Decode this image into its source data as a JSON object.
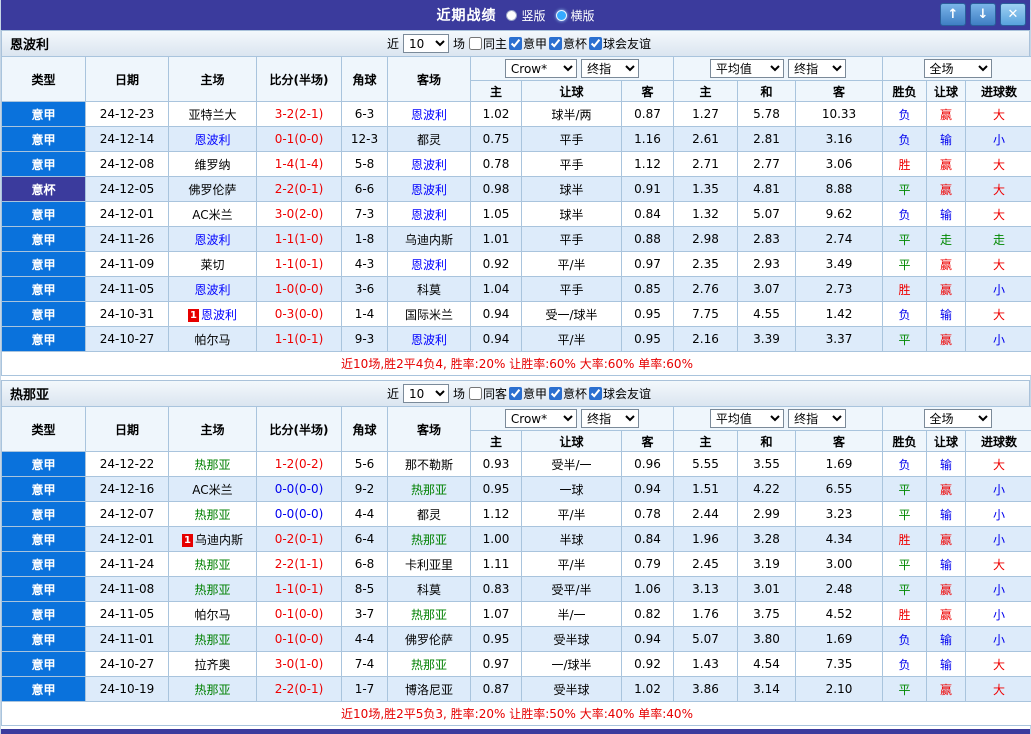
{
  "titlebar": {
    "title": "近期战绩",
    "vertical_label": "竖版",
    "horizontal_label": "横版",
    "selected_layout": "横版",
    "btn_up": "↑",
    "btn_down": "↓",
    "btn_close": "✕"
  },
  "labels": {
    "near": "近",
    "games": "场"
  },
  "colors": {
    "titlebar_bg": "#3b3b9d",
    "league_cell_bg": "#0a72dc",
    "cup_cell_bg": "#3b3b9d",
    "alt_row_bg": "#ddebfa",
    "win_red": "#ee0000",
    "lose_blue": "#0000ee",
    "draw_green": "#008800",
    "team_blue": "#0000ff",
    "team_green": "#008000",
    "summary_red": "#e60000"
  },
  "hdr": {
    "col_type": "类型",
    "col_date": "日期",
    "col_home": "主场",
    "col_score": "比分(半场)",
    "col_corner": "角球",
    "col_away": "客场",
    "dd_crow": "Crow*",
    "dd_final": "终指",
    "dd_avg": "平均值",
    "dd_full": "全场",
    "sub_home": "主",
    "sub_handicap": "让球",
    "sub_away": "客",
    "sub_draw": "和",
    "sub_result": "胜负",
    "sub_goals": "进球数"
  },
  "sections": [
    {
      "team": "恩波利",
      "filter": {
        "count": "10",
        "checks": [
          {
            "label": "同主",
            "checked": false
          },
          {
            "label": "意甲",
            "checked": true
          },
          {
            "label": "意杯",
            "checked": true
          },
          {
            "label": "球会友谊",
            "checked": true
          }
        ]
      },
      "rows": [
        {
          "league": "意甲",
          "cup": false,
          "date": "24-12-23",
          "home": "亚特兰大",
          "home_class": "",
          "home_badge": "",
          "score": "3-2(2-1)",
          "score_class": "red",
          "corner": "6-3",
          "away": "恩波利",
          "away_class": "blue",
          "away_badge": "",
          "odds": [
            "1.02",
            "球半/两",
            "0.87",
            "1.27",
            "5.78",
            "10.33"
          ],
          "result": "负",
          "result_class": "blue",
          "asian": "赢",
          "asian_class": "red",
          "ou": "大",
          "ou_class": "red"
        },
        {
          "league": "意甲",
          "cup": false,
          "date": "24-12-14",
          "home": "恩波利",
          "home_class": "blue",
          "home_badge": "",
          "score": "0-1(0-0)",
          "score_class": "red",
          "corner": "12-3",
          "away": "都灵",
          "away_class": "",
          "away_badge": "",
          "odds": [
            "0.75",
            "平手",
            "1.16",
            "2.61",
            "2.81",
            "3.16"
          ],
          "result": "负",
          "result_class": "blue",
          "asian": "输",
          "asian_class": "blue",
          "ou": "小",
          "ou_class": "blue"
        },
        {
          "league": "意甲",
          "cup": false,
          "date": "24-12-08",
          "home": "维罗纳",
          "home_class": "",
          "home_badge": "",
          "score": "1-4(1-4)",
          "score_class": "red",
          "corner": "5-8",
          "away": "恩波利",
          "away_class": "blue",
          "away_badge": "",
          "odds": [
            "0.78",
            "平手",
            "1.12",
            "2.71",
            "2.77",
            "3.06"
          ],
          "result": "胜",
          "result_class": "red",
          "asian": "赢",
          "asian_class": "red",
          "ou": "大",
          "ou_class": "red"
        },
        {
          "league": "意杯",
          "cup": true,
          "date": "24-12-05",
          "home": "佛罗伦萨",
          "home_class": "",
          "home_badge": "",
          "score": "2-2(0-1)",
          "score_class": "red",
          "corner": "6-6",
          "away": "恩波利",
          "away_class": "blue",
          "away_badge": "",
          "odds": [
            "0.98",
            "球半",
            "0.91",
            "1.35",
            "4.81",
            "8.88"
          ],
          "result": "平",
          "result_class": "green",
          "asian": "赢",
          "asian_class": "red",
          "ou": "大",
          "ou_class": "red"
        },
        {
          "league": "意甲",
          "cup": false,
          "date": "24-12-01",
          "home": "AC米兰",
          "home_class": "",
          "home_badge": "",
          "score": "3-0(2-0)",
          "score_class": "red",
          "corner": "7-3",
          "away": "恩波利",
          "away_class": "blue",
          "away_badge": "",
          "odds": [
            "1.05",
            "球半",
            "0.84",
            "1.32",
            "5.07",
            "9.62"
          ],
          "result": "负",
          "result_class": "blue",
          "asian": "输",
          "asian_class": "blue",
          "ou": "大",
          "ou_class": "red"
        },
        {
          "league": "意甲",
          "cup": false,
          "date": "24-11-26",
          "home": "恩波利",
          "home_class": "blue",
          "home_badge": "",
          "score": "1-1(1-0)",
          "score_class": "red",
          "corner": "1-8",
          "away": "乌迪内斯",
          "away_class": "",
          "away_badge": "",
          "odds": [
            "1.01",
            "平手",
            "0.88",
            "2.98",
            "2.83",
            "2.74"
          ],
          "result": "平",
          "result_class": "green",
          "asian": "走",
          "asian_class": "green",
          "ou": "走",
          "ou_class": "green"
        },
        {
          "league": "意甲",
          "cup": false,
          "date": "24-11-09",
          "home": "莱切",
          "home_class": "",
          "home_badge": "",
          "score": "1-1(0-1)",
          "score_class": "red",
          "corner": "4-3",
          "away": "恩波利",
          "away_class": "blue",
          "away_badge": "",
          "odds": [
            "0.92",
            "平/半",
            "0.97",
            "2.35",
            "2.93",
            "3.49"
          ],
          "result": "平",
          "result_class": "green",
          "asian": "赢",
          "asian_class": "red",
          "ou": "大",
          "ou_class": "red"
        },
        {
          "league": "意甲",
          "cup": false,
          "date": "24-11-05",
          "home": "恩波利",
          "home_class": "blue",
          "home_badge": "",
          "score": "1-0(0-0)",
          "score_class": "red",
          "corner": "3-6",
          "away": "科莫",
          "away_class": "",
          "away_badge": "",
          "odds": [
            "1.04",
            "平手",
            "0.85",
            "2.76",
            "3.07",
            "2.73"
          ],
          "result": "胜",
          "result_class": "red",
          "asian": "赢",
          "asian_class": "red",
          "ou": "小",
          "ou_class": "blue"
        },
        {
          "league": "意甲",
          "cup": false,
          "date": "24-10-31",
          "home": "恩波利",
          "home_class": "blue",
          "home_badge": "1",
          "score": "0-3(0-0)",
          "score_class": "red",
          "corner": "1-4",
          "away": "国际米兰",
          "away_class": "",
          "away_badge": "",
          "odds": [
            "0.94",
            "受一/球半",
            "0.95",
            "7.75",
            "4.55",
            "1.42"
          ],
          "result": "负",
          "result_class": "blue",
          "asian": "输",
          "asian_class": "blue",
          "ou": "大",
          "ou_class": "red"
        },
        {
          "league": "意甲",
          "cup": false,
          "date": "24-10-27",
          "home": "帕尔马",
          "home_class": "",
          "home_badge": "",
          "score": "1-1(0-1)",
          "score_class": "red",
          "corner": "9-3",
          "away": "恩波利",
          "away_class": "blue",
          "away_badge": "",
          "odds": [
            "0.94",
            "平/半",
            "0.95",
            "2.16",
            "3.39",
            "3.37"
          ],
          "result": "平",
          "result_class": "green",
          "asian": "赢",
          "asian_class": "red",
          "ou": "小",
          "ou_class": "blue"
        }
      ],
      "summary": "近10场,胜2平4负4, 胜率:20% 让胜率:60% 大率:60% 单率:60%"
    },
    {
      "team": "热那亚",
      "filter": {
        "count": "10",
        "checks": [
          {
            "label": "同客",
            "checked": false
          },
          {
            "label": "意甲",
            "checked": true
          },
          {
            "label": "意杯",
            "checked": true
          },
          {
            "label": "球会友谊",
            "checked": true
          }
        ]
      },
      "rows": [
        {
          "league": "意甲",
          "cup": false,
          "date": "24-12-22",
          "home": "热那亚",
          "home_class": "green",
          "home_badge": "",
          "score": "1-2(0-2)",
          "score_class": "red",
          "corner": "5-6",
          "away": "那不勒斯",
          "away_class": "",
          "away_badge": "",
          "odds": [
            "0.93",
            "受半/一",
            "0.96",
            "5.55",
            "3.55",
            "1.69"
          ],
          "result": "负",
          "result_class": "blue",
          "asian": "输",
          "asian_class": "blue",
          "ou": "大",
          "ou_class": "red"
        },
        {
          "league": "意甲",
          "cup": false,
          "date": "24-12-16",
          "home": "AC米兰",
          "home_class": "",
          "home_badge": "",
          "score": "0-0(0-0)",
          "score_class": "blue",
          "corner": "9-2",
          "away": "热那亚",
          "away_class": "green",
          "away_badge": "",
          "odds": [
            "0.95",
            "一球",
            "0.94",
            "1.51",
            "4.22",
            "6.55"
          ],
          "result": "平",
          "result_class": "green",
          "asian": "赢",
          "asian_class": "red",
          "ou": "小",
          "ou_class": "blue"
        },
        {
          "league": "意甲",
          "cup": false,
          "date": "24-12-07",
          "home": "热那亚",
          "home_class": "green",
          "home_badge": "",
          "score": "0-0(0-0)",
          "score_class": "blue",
          "corner": "4-4",
          "away": "都灵",
          "away_class": "",
          "away_badge": "",
          "odds": [
            "1.12",
            "平/半",
            "0.78",
            "2.44",
            "2.99",
            "3.23"
          ],
          "result": "平",
          "result_class": "green",
          "asian": "输",
          "asian_class": "blue",
          "ou": "小",
          "ou_class": "blue"
        },
        {
          "league": "意甲",
          "cup": false,
          "date": "24-12-01",
          "home": "乌迪内斯",
          "home_class": "",
          "home_badge": "1",
          "score": "0-2(0-1)",
          "score_class": "red",
          "corner": "6-4",
          "away": "热那亚",
          "away_class": "green",
          "away_badge": "",
          "odds": [
            "1.00",
            "半球",
            "0.84",
            "1.96",
            "3.28",
            "4.34"
          ],
          "result": "胜",
          "result_class": "red",
          "asian": "赢",
          "asian_class": "red",
          "ou": "小",
          "ou_class": "blue"
        },
        {
          "league": "意甲",
          "cup": false,
          "date": "24-11-24",
          "home": "热那亚",
          "home_class": "green",
          "home_badge": "",
          "score": "2-2(1-1)",
          "score_class": "red",
          "corner": "6-8",
          "away": "卡利亚里",
          "away_class": "",
          "away_badge": "",
          "odds": [
            "1.11",
            "平/半",
            "0.79",
            "2.45",
            "3.19",
            "3.00"
          ],
          "result": "平",
          "result_class": "green",
          "asian": "输",
          "asian_class": "blue",
          "ou": "大",
          "ou_class": "red"
        },
        {
          "league": "意甲",
          "cup": false,
          "date": "24-11-08",
          "home": "热那亚",
          "home_class": "green",
          "home_badge": "",
          "score": "1-1(0-1)",
          "score_class": "red",
          "corner": "8-5",
          "away": "科莫",
          "away_class": "",
          "away_badge": "",
          "odds": [
            "0.83",
            "受平/半",
            "1.06",
            "3.13",
            "3.01",
            "2.48"
          ],
          "result": "平",
          "result_class": "green",
          "asian": "赢",
          "asian_class": "red",
          "ou": "小",
          "ou_class": "blue"
        },
        {
          "league": "意甲",
          "cup": false,
          "date": "24-11-05",
          "home": "帕尔马",
          "home_class": "",
          "home_badge": "",
          "score": "0-1(0-0)",
          "score_class": "red",
          "corner": "3-7",
          "away": "热那亚",
          "away_class": "green",
          "away_badge": "",
          "odds": [
            "1.07",
            "半/一",
            "0.82",
            "1.76",
            "3.75",
            "4.52"
          ],
          "result": "胜",
          "result_class": "red",
          "asian": "赢",
          "asian_class": "red",
          "ou": "小",
          "ou_class": "blue"
        },
        {
          "league": "意甲",
          "cup": false,
          "date": "24-11-01",
          "home": "热那亚",
          "home_class": "green",
          "home_badge": "",
          "score": "0-1(0-0)",
          "score_class": "red",
          "corner": "4-4",
          "away": "佛罗伦萨",
          "away_class": "",
          "away_badge": "",
          "odds": [
            "0.95",
            "受半球",
            "0.94",
            "5.07",
            "3.80",
            "1.69"
          ],
          "result": "负",
          "result_class": "blue",
          "asian": "输",
          "asian_class": "blue",
          "ou": "小",
          "ou_class": "blue"
        },
        {
          "league": "意甲",
          "cup": false,
          "date": "24-10-27",
          "home": "拉齐奥",
          "home_class": "",
          "home_badge": "",
          "score": "3-0(1-0)",
          "score_class": "red",
          "corner": "7-4",
          "away": "热那亚",
          "away_class": "green",
          "away_badge": "",
          "odds": [
            "0.97",
            "一/球半",
            "0.92",
            "1.43",
            "4.54",
            "7.35"
          ],
          "result": "负",
          "result_class": "blue",
          "asian": "输",
          "asian_class": "blue",
          "ou": "大",
          "ou_class": "red"
        },
        {
          "league": "意甲",
          "cup": false,
          "date": "24-10-19",
          "home": "热那亚",
          "home_class": "green",
          "home_badge": "",
          "score": "2-2(0-1)",
          "score_class": "red",
          "corner": "1-7",
          "away": "博洛尼亚",
          "away_class": "",
          "away_badge": "",
          "odds": [
            "0.87",
            "受半球",
            "1.02",
            "3.86",
            "3.14",
            "2.10"
          ],
          "result": "平",
          "result_class": "green",
          "asian": "赢",
          "asian_class": "red",
          "ou": "大",
          "ou_class": "red"
        }
      ],
      "summary": "近10场,胜2平5负3, 胜率:20% 让胜率:50% 大率:40% 单率:40%"
    }
  ]
}
